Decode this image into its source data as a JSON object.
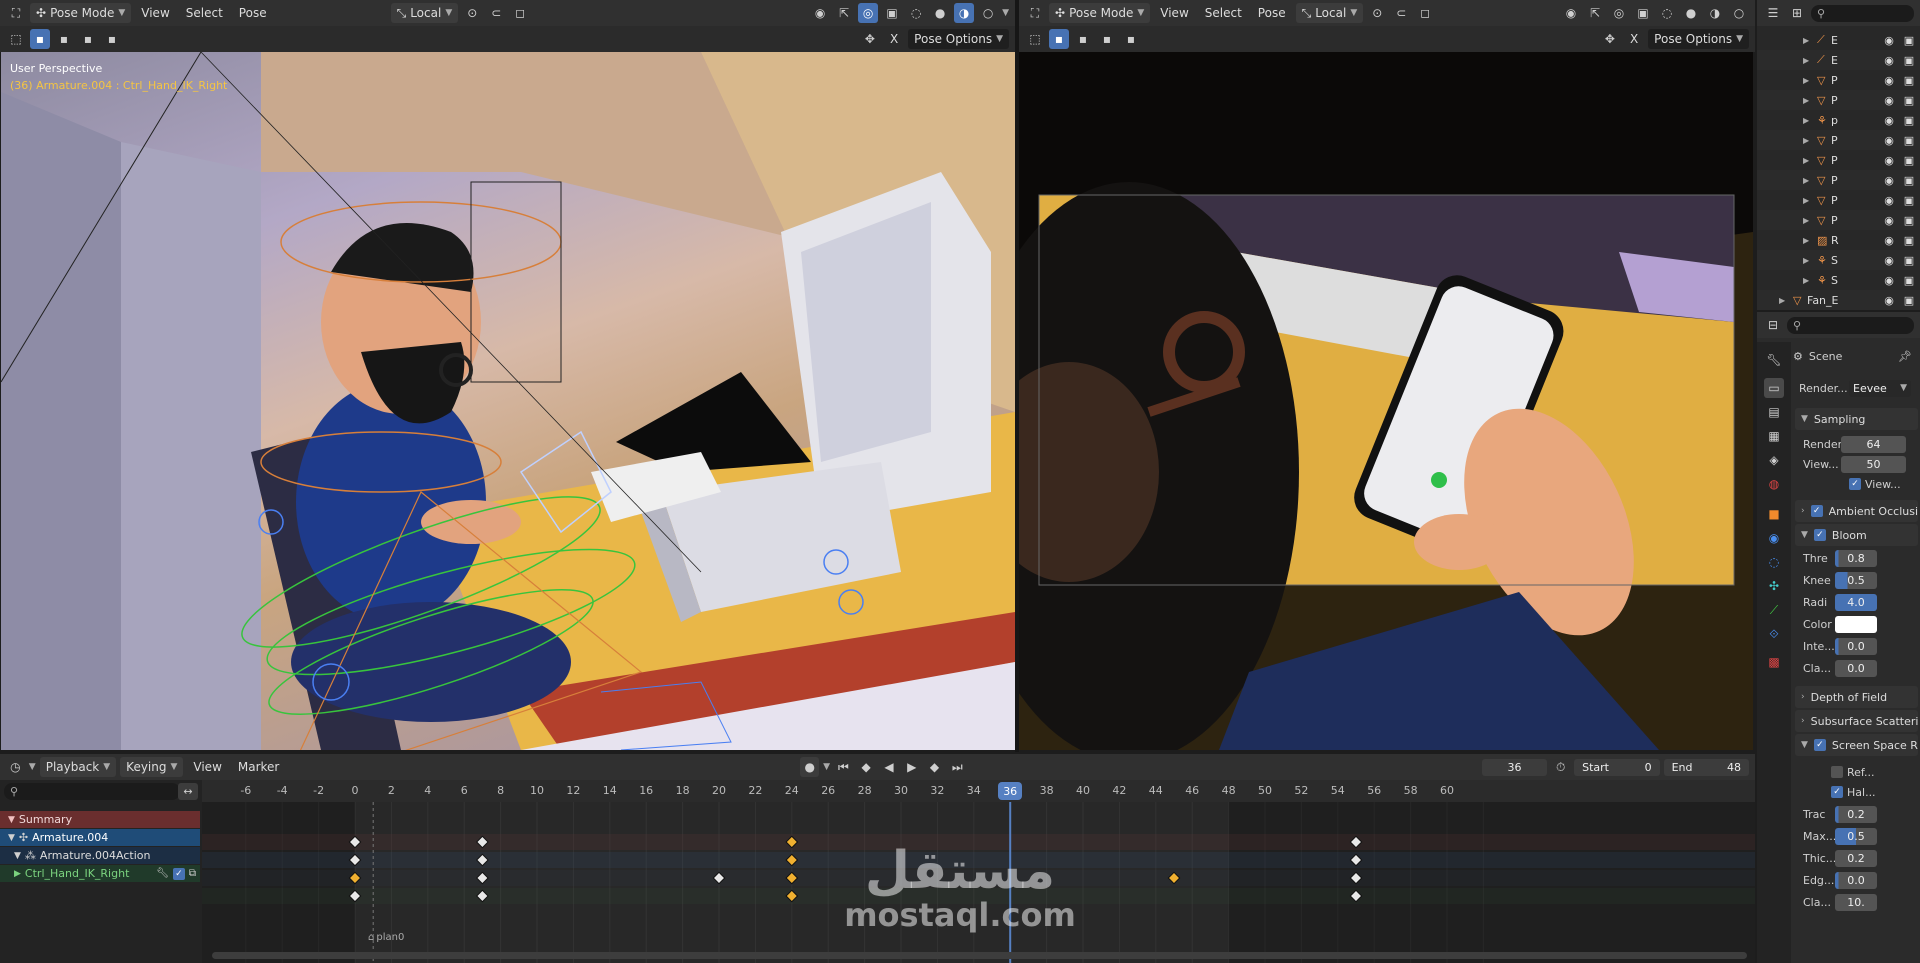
{
  "left_header": {
    "mode": "Pose Mode",
    "menus": [
      "View",
      "Select",
      "Pose"
    ],
    "transform_orientation": "Local"
  },
  "right_header": {
    "mode": "Pose Mode",
    "menus": [
      "View",
      "Select",
      "Pose"
    ],
    "transform_orientation": "Local"
  },
  "left_viewport": {
    "pose_options": "Pose Options",
    "close": "X",
    "label_view": "User Perspective",
    "label_object": "(36) Armature.004 : Ctrl_Hand_IK_Right"
  },
  "right_viewport": {
    "pose_options": "Pose Options",
    "close": "X"
  },
  "timeline": {
    "menus": [
      "Playback",
      "Keying",
      "View",
      "Marker"
    ],
    "current_frame": "36",
    "start_label": "Start",
    "start_value": "0",
    "end_label": "End",
    "end_value": "48",
    "ruler_ticks": [
      "-6",
      "-4",
      "-2",
      "0",
      "2",
      "4",
      "6",
      "8",
      "10",
      "12",
      "14",
      "16",
      "18",
      "20",
      "22",
      "24",
      "26",
      "28",
      "30",
      "32",
      "34",
      "36",
      "38",
      "40",
      "42",
      "44",
      "46",
      "48",
      "50",
      "52",
      "54",
      "56",
      "58",
      "60"
    ],
    "current_marker": "36",
    "marker_name": "plan0",
    "channels": [
      "Summary",
      "Armature.004",
      "Armature.004Action",
      "Ctrl_Hand_IK_Right"
    ]
  },
  "keyframes": [
    {
      "row": 0,
      "frames": [
        0,
        7,
        24,
        55
      ],
      "selected": [
        24
      ]
    },
    {
      "row": 1,
      "frames": [
        0,
        7,
        24,
        55
      ],
      "selected": [
        24
      ]
    },
    {
      "row": 2,
      "frames": [
        0,
        7,
        20,
        24,
        45,
        55
      ],
      "selected": [
        0,
        24,
        45
      ]
    },
    {
      "row": 3,
      "frames": [
        0,
        7,
        24,
        55
      ],
      "selected": [
        24
      ]
    }
  ],
  "outliner": {
    "rows": [
      "E",
      "E",
      "P",
      "P",
      "p",
      "P",
      "P",
      "P",
      "P",
      "P",
      "R",
      "S",
      "S",
      "Fan_E"
    ]
  },
  "properties": {
    "scene": "Scene",
    "render_engine_label": "Render...",
    "render_engine": "Eevee",
    "sampling": "Sampling",
    "render_samples_label": "Render",
    "render_samples": "64",
    "viewport_samples_label": "View...",
    "viewport_samples": "50",
    "viewport_denoise": "View...",
    "ambient_occlusion": "Ambient Occlusi",
    "bloom": "Bloom",
    "bloom_threshold_label": "Thre",
    "bloom_threshold": "0.8",
    "bloom_knee_label": "Knee",
    "bloom_knee": "0.5",
    "bloom_radius_label": "Radi",
    "bloom_radius": "4.0",
    "bloom_color_label": "Color",
    "bloom_intensity_label": "Inte...",
    "bloom_intensity": "0.0",
    "bloom_clamp_label": "Cla...",
    "bloom_clamp": "0.0",
    "depth_of_field": "Depth of Field",
    "sss": "Subsurface Scatteri",
    "ssr": "Screen Space R",
    "ssr_refraction": "Ref...",
    "ssr_half": "Hal...",
    "ssr_trace_label": "Trac",
    "ssr_trace": "0.2",
    "ssr_max_label": "Max...",
    "ssr_max": "0.5",
    "ssr_thick_label": "Thic...",
    "ssr_thick": "0.2",
    "ssr_edge_label": "Edg...",
    "ssr_edge": "0.0",
    "ssr_clamp_label": "Cla...",
    "ssr_clamp": "10."
  },
  "watermark": {
    "arabic": "مستقل",
    "latin": "mostaql.com"
  },
  "colors": {
    "accent": "#4772b3",
    "keyframe": "#e8e8e8",
    "keyframe_selected": "#f0b030",
    "summary_row": "#6a2e2e",
    "object_row": "#1f4c78",
    "playhead": "#5680c2"
  }
}
